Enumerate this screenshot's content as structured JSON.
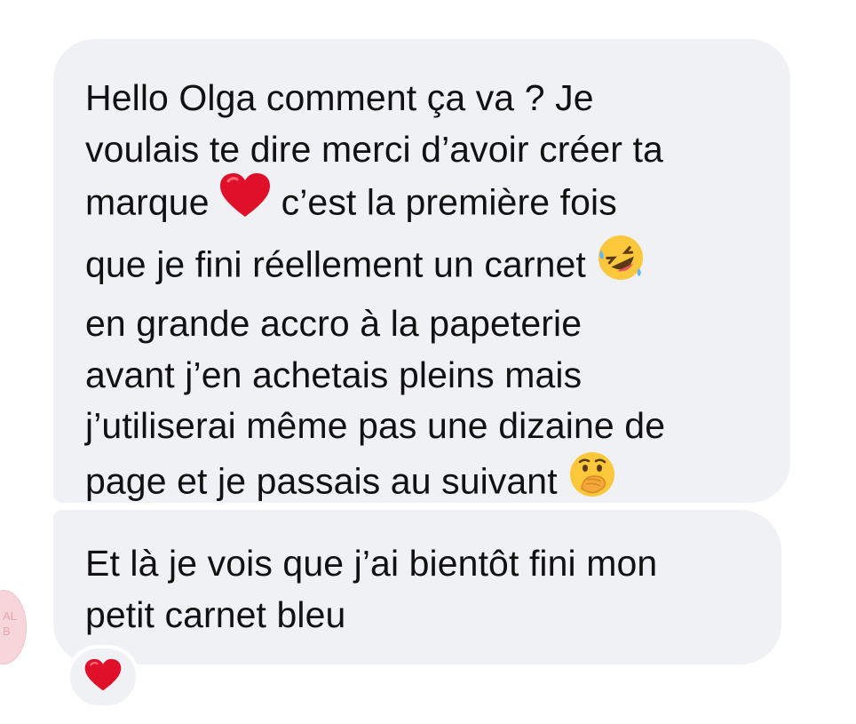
{
  "conversation": {
    "messages": [
      {
        "lines": [
          "Hello Olga comment ça va ? Je",
          "voulais te dire merci d’avoir créer ta",
          "marque",
          "c’est la première fois",
          "que je fini réellement un carnet",
          "en grande accro à la papeterie",
          "avant j’en achetais pleins mais",
          "j’utiliserai même pas une dizaine de",
          "page et je passais au suivant"
        ],
        "emojis": [
          "red-heart-emoji",
          "rolling-laughing-emoji",
          "hand-over-mouth-emoji"
        ]
      },
      {
        "lines": [
          "Et là je vois que j’ai bientôt fini mon",
          "petit carnet bleu"
        ]
      }
    ],
    "avatar": {
      "partial_text": "AL\nB"
    },
    "reaction": {
      "icon": "red-heart-icon"
    }
  },
  "colors": {
    "bubble_bg": "#f0f1f4",
    "text": "#111111",
    "heart": "#e0102a",
    "emoji_yellow": "#fbc73b"
  }
}
